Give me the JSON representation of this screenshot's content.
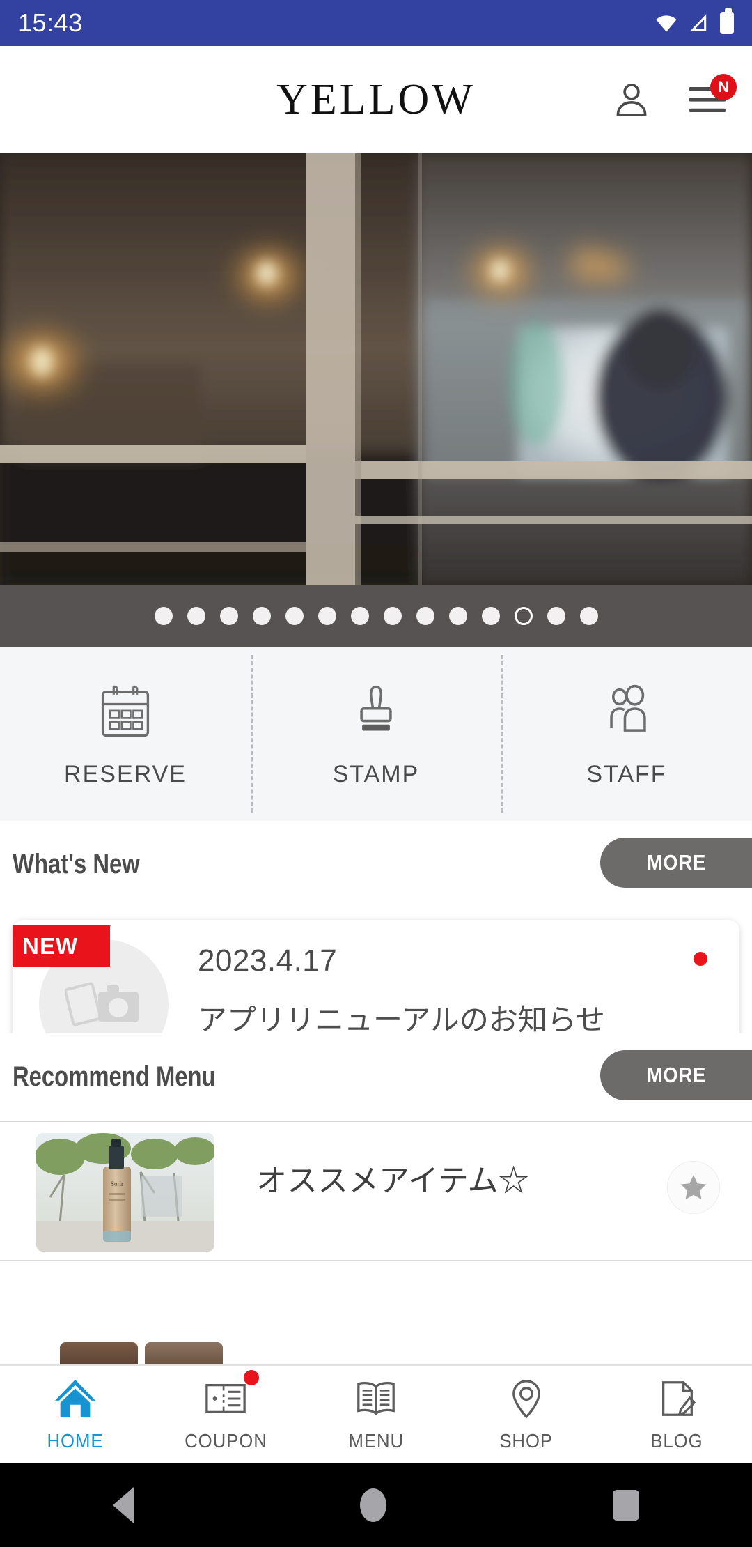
{
  "status_bar": {
    "time": "15:43",
    "background_color": "#3342a0",
    "icons": [
      "wifi-icon",
      "cellular-signal-icon",
      "battery-icon"
    ]
  },
  "header": {
    "logo_text": "YELLOW",
    "account_icon": "person-icon",
    "menu_icon": "hamburger-menu-icon",
    "menu_badge": "N",
    "badge_color": "#e00f18"
  },
  "carousel": {
    "slide_count": 14,
    "active_index": 11,
    "indicator_background": "#585353",
    "image_description": "Dim cafe/salon interior seen through white paned window, warm pendant lamps and bright doorway"
  },
  "quick_actions": [
    {
      "label": "RESERVE",
      "icon": "calendar-icon"
    },
    {
      "label": "STAMP",
      "icon": "stamp-icon"
    },
    {
      "label": "STAFF",
      "icon": "people-icon"
    }
  ],
  "whats_new": {
    "section_title": "What's New",
    "more_label": "MORE",
    "items": [
      {
        "badge": "NEW",
        "badge_color": "#e8131b",
        "date": "2023.4.17",
        "title": "アプリリニューアルのお知らせ",
        "thumbnail_icon": "photo-placeholder-icon",
        "unread_dot": true
      }
    ]
  },
  "recommend_menu": {
    "section_title": "Recommend Menu",
    "more_label": "MORE",
    "items": [
      {
        "title": "オススメアイテム☆",
        "favorite_icon": "star-icon",
        "thumbnail_description": "Cosmetic pump bottle outdoors with green trees"
      }
    ]
  },
  "bottom_nav": {
    "active_color": "#1793d1",
    "inactive_color": "#5a5a5a",
    "items": [
      {
        "label": "HOME",
        "icon": "home-icon",
        "active": true,
        "badge": false
      },
      {
        "label": "COUPON",
        "icon": "coupon-icon",
        "active": false,
        "badge": true
      },
      {
        "label": "MENU",
        "icon": "book-icon",
        "active": false,
        "badge": false
      },
      {
        "label": "SHOP",
        "icon": "map-pin-icon",
        "active": false,
        "badge": false
      },
      {
        "label": "BLOG",
        "icon": "document-pencil-icon",
        "active": false,
        "badge": false
      }
    ]
  },
  "android_nav": {
    "back": "back-triangle-icon",
    "home": "home-circle-icon",
    "recents": "recents-square-icon"
  }
}
